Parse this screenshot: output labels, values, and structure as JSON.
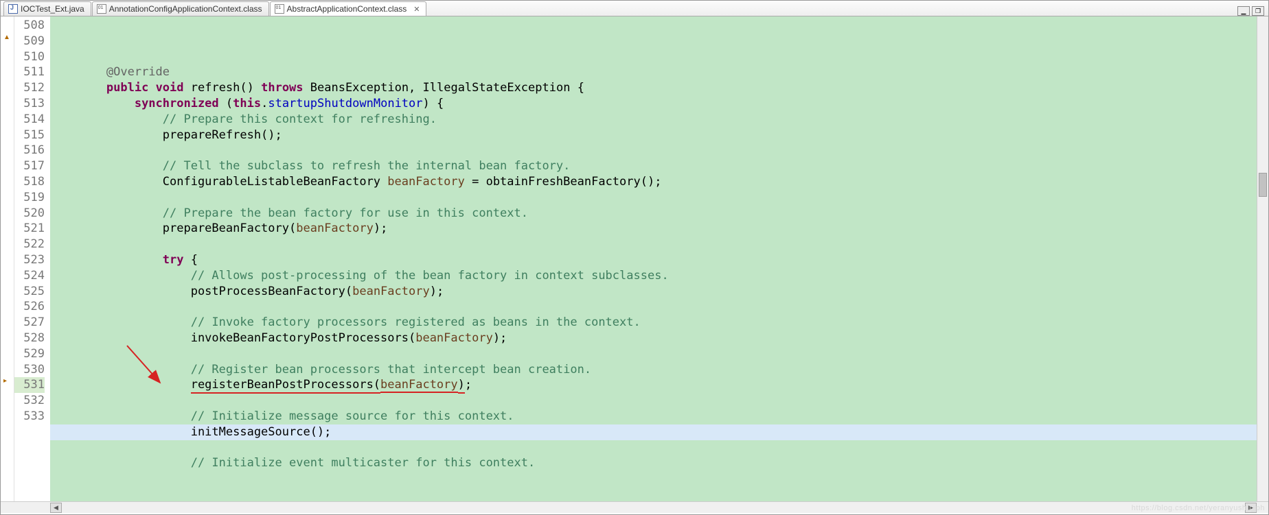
{
  "tabs": [
    {
      "label": "IOCTest_Ext.java",
      "active": false,
      "iconClass": "java"
    },
    {
      "label": "AnnotationConfigApplicationContext.class",
      "active": false,
      "iconClass": "class"
    },
    {
      "label": "AbstractApplicationContext.class",
      "active": true,
      "iconClass": "class"
    }
  ],
  "titleButtons": {
    "min": "▁",
    "max": "❐"
  },
  "closeGlyph": "✕",
  "gutter": {
    "start": 508,
    "end": 533,
    "highlight": 531,
    "overrideAt": 509
  },
  "code": {
    "508": {
      "indent": "        ",
      "spans": [
        {
          "cls": "annot",
          "t": "@Override"
        }
      ]
    },
    "509": {
      "indent": "        ",
      "spans": [
        {
          "cls": "kw",
          "t": "public"
        },
        {
          "t": " "
        },
        {
          "cls": "kw",
          "t": "void"
        },
        {
          "t": " refresh() "
        },
        {
          "cls": "kw",
          "t": "throws"
        },
        {
          "t": " BeansException, IllegalStateException {"
        }
      ]
    },
    "510": {
      "indent": "            ",
      "spans": [
        {
          "cls": "kw",
          "t": "synchronized"
        },
        {
          "t": " ("
        },
        {
          "cls": "kw",
          "t": "this"
        },
        {
          "t": "."
        },
        {
          "cls": "fld",
          "t": "startupShutdownMonitor"
        },
        {
          "t": ") {"
        }
      ]
    },
    "511": {
      "indent": "                ",
      "spans": [
        {
          "cls": "cmt",
          "t": "// Prepare this context for refreshing."
        }
      ]
    },
    "512": {
      "indent": "                ",
      "spans": [
        {
          "t": "prepareRefresh();"
        }
      ]
    },
    "513": {
      "indent": "",
      "spans": []
    },
    "514": {
      "indent": "                ",
      "spans": [
        {
          "cls": "cmt",
          "t": "// Tell the subclass to refresh the internal bean factory."
        }
      ]
    },
    "515": {
      "indent": "                ",
      "spans": [
        {
          "t": "ConfigurableListableBeanFactory "
        },
        {
          "cls": "prm",
          "t": "beanFactory"
        },
        {
          "t": " = obtainFreshBeanFactory();"
        }
      ]
    },
    "516": {
      "indent": "",
      "spans": []
    },
    "517": {
      "indent": "                ",
      "spans": [
        {
          "cls": "cmt",
          "t": "// Prepare the bean factory for use in this context."
        }
      ]
    },
    "518": {
      "indent": "                ",
      "spans": [
        {
          "t": "prepareBeanFactory("
        },
        {
          "cls": "prm",
          "t": "beanFactory"
        },
        {
          "t": ");"
        }
      ]
    },
    "519": {
      "indent": "",
      "spans": []
    },
    "520": {
      "indent": "                ",
      "spans": [
        {
          "cls": "kw",
          "t": "try"
        },
        {
          "t": " {"
        }
      ]
    },
    "521": {
      "indent": "                    ",
      "spans": [
        {
          "cls": "cmt",
          "t": "// Allows post-processing of the bean factory in context subclasses."
        }
      ]
    },
    "522": {
      "indent": "                    ",
      "spans": [
        {
          "t": "postProcessBeanFactory("
        },
        {
          "cls": "prm",
          "t": "beanFactory"
        },
        {
          "t": ");"
        }
      ]
    },
    "523": {
      "indent": "",
      "spans": []
    },
    "524": {
      "indent": "                    ",
      "spans": [
        {
          "cls": "cmt",
          "t": "// Invoke factory processors registered as beans in the context."
        }
      ]
    },
    "525": {
      "indent": "                    ",
      "spans": [
        {
          "t": "invokeBeanFactoryPostProcessors("
        },
        {
          "cls": "prm",
          "t": "beanFactory"
        },
        {
          "t": ");"
        }
      ]
    },
    "526": {
      "indent": "",
      "spans": []
    },
    "527": {
      "indent": "                    ",
      "spans": [
        {
          "cls": "cmt",
          "t": "// Register bean processors that intercept bean creation."
        }
      ]
    },
    "528": {
      "indent": "                    ",
      "spans": [
        {
          "cls": "underline-red",
          "t": "registerBeanPostProcessors("
        },
        {
          "cls": "prm underline-red2",
          "t": "beanFactory"
        },
        {
          "cls": "underline-red",
          "t": ")"
        },
        {
          "t": ";"
        }
      ]
    },
    "529": {
      "indent": "",
      "spans": []
    },
    "530": {
      "indent": "                    ",
      "spans": [
        {
          "cls": "cmt",
          "t": "// Initialize message source for this context."
        }
      ]
    },
    "531": {
      "indent": "                    ",
      "spans": [
        {
          "t": "initMessageSource();"
        }
      ],
      "hl": true
    },
    "532": {
      "indent": "",
      "spans": []
    },
    "533": {
      "indent": "                    ",
      "spans": [
        {
          "cls": "cmt",
          "t": "// Initialize event multicaster for this context."
        }
      ]
    }
  },
  "hscroll": {
    "left": "◀",
    "right": "▶"
  },
  "watermark": "https://blog.csdn.net/yeranyushu_ph"
}
